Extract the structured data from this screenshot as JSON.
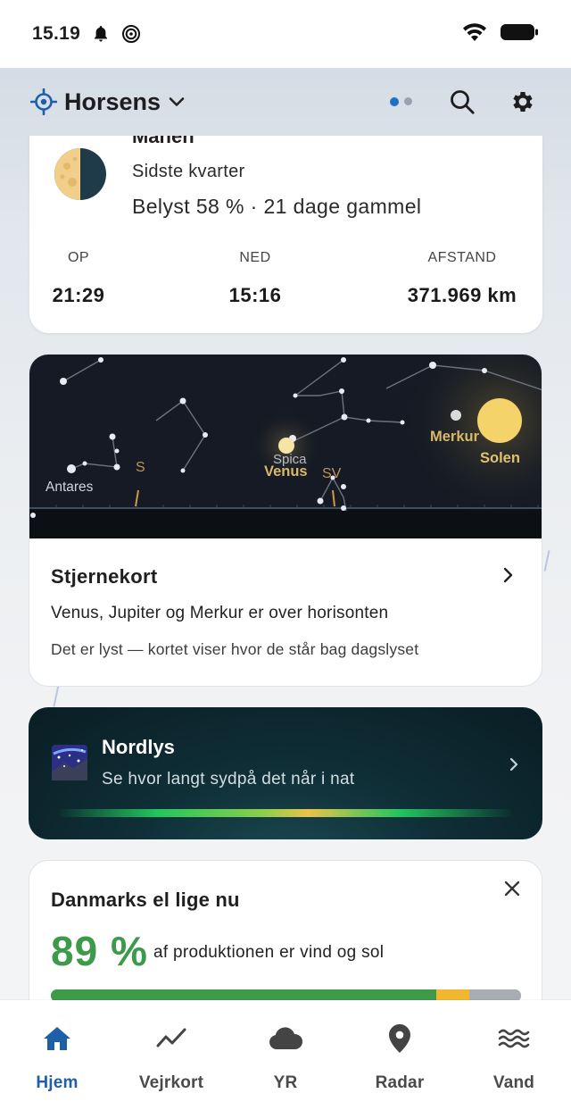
{
  "status_bar": {
    "time": "15.19"
  },
  "header": {
    "location": "Horsens"
  },
  "moon": {
    "title": "Månen",
    "phase": "Sidste kvarter",
    "illumination": "Belyst 58 % · 21 dage gammel",
    "stats": [
      {
        "label": "OP",
        "value": "21:29"
      },
      {
        "label": "NED",
        "value": "15:16"
      },
      {
        "label": "AFSTAND",
        "value": "371.969 km"
      }
    ]
  },
  "star_chart": {
    "labels": {
      "antares": "Antares",
      "spica": "Spica",
      "venus": "Venus",
      "merkur": "Merkur",
      "solen": "Solen",
      "s": "S",
      "sv": "SV"
    },
    "title": "Stjernekort",
    "line1": "Venus, Jupiter og Merkur er over horisonten",
    "line2": "Det er lyst — kortet viser hvor de står bag dagslyset"
  },
  "aurora": {
    "title": "Nordlys",
    "subtitle": "Se hvor langt sydpå det når i nat"
  },
  "power": {
    "title": "Danmarks el lige nu",
    "percent": "89 %",
    "description": "af produktionen er vind og sol",
    "mix": {
      "green": 0.82,
      "yellow": 0.07,
      "gray": 0.11
    },
    "colors": {
      "green": "#3d9a4a",
      "yellow": "#f2b731",
      "gray": "#a9adb3"
    }
  },
  "nav": {
    "items": [
      {
        "label": "Hjem",
        "icon": "home-icon"
      },
      {
        "label": "Vejrkort",
        "icon": "trend-icon"
      },
      {
        "label": "YR",
        "icon": "cloud-icon"
      },
      {
        "label": "Radar",
        "icon": "location-pin-icon"
      },
      {
        "label": "Vand",
        "icon": "waves-icon"
      }
    ]
  },
  "colors": {
    "accent": "#1f5fa8",
    "green": "#3d9a4a"
  }
}
